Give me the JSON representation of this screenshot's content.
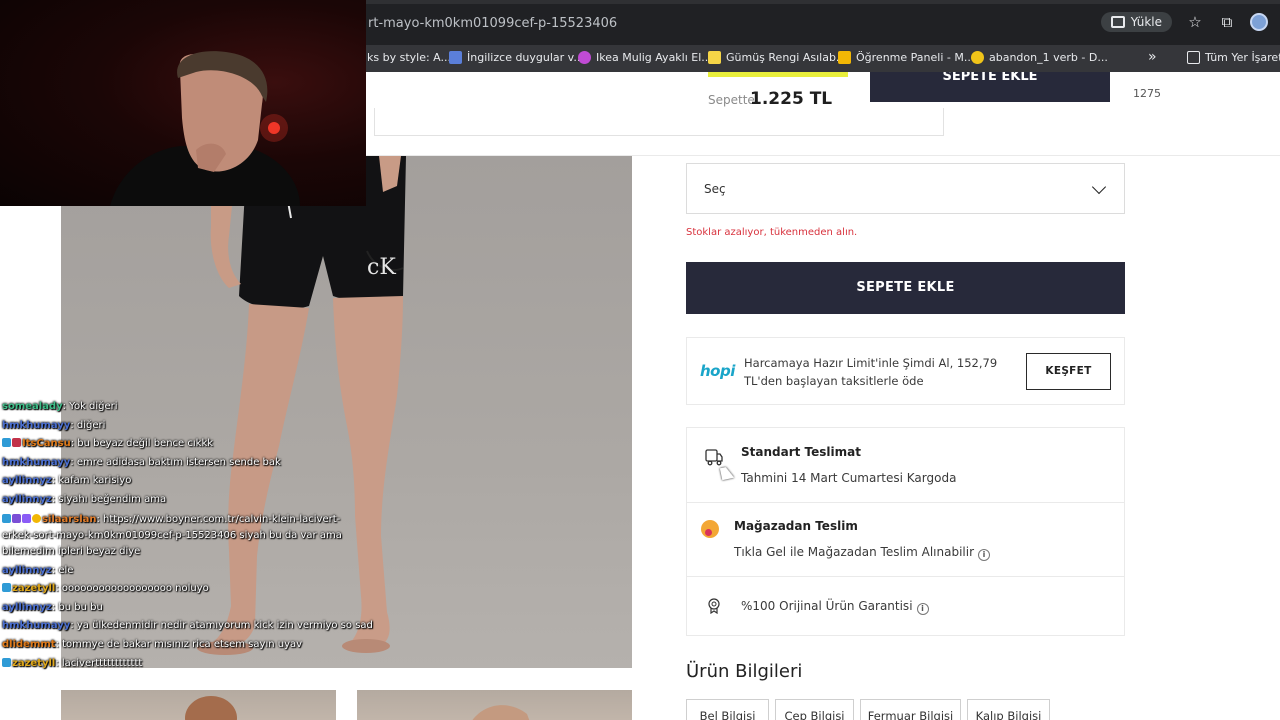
{
  "browser": {
    "url": "rt-mayo-km0km01099cef-p-15523406",
    "upload_label": "Yükle",
    "bookmarks": [
      {
        "label": "ks by style: A...",
        "color": "#e8eaed"
      },
      {
        "label": "İngilizce duygular v...",
        "color": "#5b7fd9"
      },
      {
        "label": "Ikea Mulig Ayaklı El...",
        "color": "#c04bd4"
      },
      {
        "label": "Gümüş Rengi Asılab...",
        "color": "#f5d547"
      },
      {
        "label": "Öğrenme Paneli - M...",
        "color": "#f2b705"
      },
      {
        "label": "abandon_1 verb - D...",
        "color": "#f0c419"
      }
    ],
    "more_bookmarks": "»",
    "all_bookmarks_label": "Tüm Yer İşaretleri"
  },
  "sticky_header": {
    "price_label": "Sepette",
    "price_value": "1.225 TL",
    "cart_button": "SEPETE EKLE",
    "stock_number": "1275"
  },
  "product": {
    "size_select_placeholder": "Seç",
    "stock_warning": "Stoklar azalıyor, tükenmeden alın.",
    "add_to_cart": "SEPETE EKLE",
    "hopi": {
      "logo": "hopi",
      "text": "Harcamaya Hazır Limit'inle Şimdi Al, 152,79 TL'den başlayan taksitlerle öde",
      "button": "KEŞFET"
    },
    "delivery": {
      "standard_title": "Standart Teslimat",
      "standard_sub": "Tahmini 14 Mart Cumartesi Kargoda",
      "store_title": "Mağazadan Teslim",
      "store_sub": "Tıkla Gel ile Mağazadan Teslim Alınabilir",
      "original_text": "%100 Orijinal Ürün Garantisi"
    },
    "info_title": "Ürün Bilgileri",
    "info_tabs": [
      "Bel Bilgisi",
      "Cep Bilgisi",
      "Fermuar Bilgisi",
      "Kalıp Bilgisi"
    ]
  },
  "chat": [
    {
      "user": "somealady",
      "color": "#3fbf8a",
      "text": ": Yok diğeri"
    },
    {
      "user": "hmkhumayy",
      "color": "#4a6fd1",
      "text": ": diğeri"
    },
    {
      "user": "ItsCansu",
      "color": "#e07b1a",
      "text": ": bu beyaz değil bence cıkkk",
      "badges": [
        "#2f9bd6",
        "#c2334a"
      ]
    },
    {
      "user": "hmkhumayy",
      "color": "#4a6fd1",
      "text": ": emre adidasa baktım istersen sende bak"
    },
    {
      "user": "ayllinnyz",
      "color": "#4a6fd1",
      "text": ": kafam karisiyo"
    },
    {
      "user": "ayllinnyz",
      "color": "#4a6fd1",
      "text": ": siyahı beğendim ama"
    },
    {
      "user": "silaarslan",
      "color": "#e27d2b",
      "text": ": https://www.boyner.com.tr/calvin-klein-lacivert-erkek-sort-mayo-km0km01099cef-p-15523406 siyah bu da var ama bilemedim ipleri beyaz diye",
      "badges": [
        "#2f9bd6",
        "#7b4fd6",
        "#8b5cf6",
        "#f2b705"
      ]
    },
    {
      "user": "ayllinnyz",
      "color": "#4a6fd1",
      "text": ": ele"
    },
    {
      "user": "zazetyll",
      "color": "#e0a81a",
      "text": ": oooooooooooooooooo noluyo",
      "badges": [
        "#2f9bd6"
      ]
    },
    {
      "user": "ayllinnyz",
      "color": "#4a6fd1",
      "text": ": bu bu bu"
    },
    {
      "user": "hmkhumayy",
      "color": "#4a6fd1",
      "text": ": ya ülkedenmidir nedir atamıyorum kick izin vermiyo so sad"
    },
    {
      "user": "dlidemmt",
      "color": "#e07b1a",
      "text": ": tommye de bakar mısınız rica etsem sayın uyav"
    },
    {
      "user": "zazetyll",
      "color": "#e0a81a",
      "text": ": lacivertttttttttttt",
      "badges": [
        "#2f9bd6"
      ]
    }
  ],
  "colors": {
    "dark_button": "#27293a",
    "warning": "#d8323d",
    "hopi_blue": "#1aa5c9"
  }
}
